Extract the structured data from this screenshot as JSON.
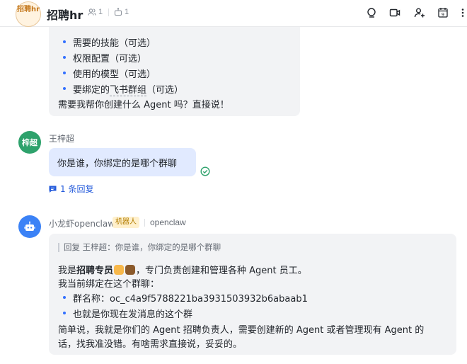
{
  "header": {
    "avatar_text": "招聘hr",
    "title": "招聘hr",
    "member_count": "1",
    "bot_count": "1",
    "icons": [
      "search-icon",
      "video-icon",
      "add-member-icon",
      "calendar-icon",
      "more-icon"
    ],
    "calendar_day": "9"
  },
  "top_message": {
    "bullets": [
      "需要的技能（可选）",
      "权限配置（可选）",
      "使用的模型（可选）"
    ],
    "bullet4_prefix": "要绑定的",
    "bullet4_link": "飞书群组",
    "bullet4_suffix": "（可选）",
    "closing": "需要我帮你创建什么 Agent 吗？直接说！"
  },
  "user_message": {
    "avatar_text": "梓超",
    "avatar_color": "#2ea26c",
    "sender": "王梓超",
    "text": "你是谁，你绑定的是哪个群聊",
    "reply_count": "1 条回复"
  },
  "bot_message": {
    "sender": "小龙虾openclaw",
    "tag": "机器人",
    "source": "openclaw",
    "avatar_color": "#3b82f6",
    "quote": "回复 王梓超：你是谁，你绑定的是哪个群聊",
    "line1_prefix": "我是",
    "line1_bold": "招聘专员",
    "line1_suffix": "，专门负责创建和管理各种 Agent 员工。",
    "line2": "我当前绑定在这个群聊：",
    "bullet1": "群名称：oc_c4a9f5788221ba3931503932b6abaab1",
    "bullet2": "也就是你现在发消息的这个群",
    "line3": "简单说，我就是你们的 Agent 招聘负责人，需要创建新的 Agent 或者管理现有 Agent 的",
    "line4": "话，找我准没错。有啥需求直接说，妥妥的。"
  },
  "colors": {
    "accent": "#3370ff",
    "link": "#245bdb",
    "bubble_gray": "#f2f3f5",
    "bubble_blue": "#e1eaff",
    "read_check": "#2ea26c"
  }
}
